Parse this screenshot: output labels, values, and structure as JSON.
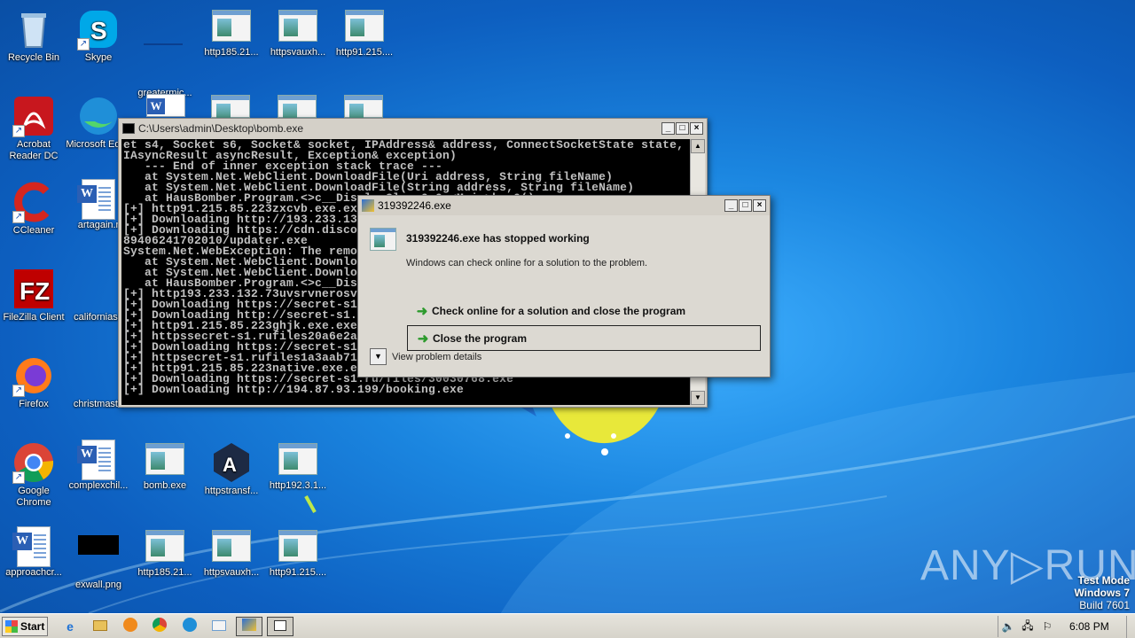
{
  "desktop": {
    "icons": [
      {
        "label": "Recycle Bin",
        "icon": "recycle-bin-icon"
      },
      {
        "label": "Skype",
        "icon": "skype-icon"
      },
      {
        "label": "greatermic...",
        "icon": "blank-file-icon"
      },
      {
        "label": "http185.21...",
        "icon": "exe-file-icon"
      },
      {
        "label": "httpsvauxh...",
        "icon": "exe-file-icon"
      },
      {
        "label": "http91.215....",
        "icon": "exe-file-icon"
      },
      {
        "label": "Acrobat Reader DC",
        "icon": "acrobat-icon"
      },
      {
        "label": "Microsoft Edge",
        "icon": "edge-icon"
      },
      {
        "label": "CCleaner",
        "icon": "ccleaner-icon"
      },
      {
        "label": "artagain.r",
        "icon": "word-doc-icon"
      },
      {
        "label": "FileZilla Client",
        "icon": "filezilla-icon"
      },
      {
        "label": "californiaso",
        "icon": "blank-file-icon"
      },
      {
        "label": "Firefox",
        "icon": "firefox-icon"
      },
      {
        "label": "christmasth",
        "icon": "blank-file-icon"
      },
      {
        "label": "Google Chrome",
        "icon": "chrome-icon"
      },
      {
        "label": "complexchil...",
        "icon": "word-doc-icon"
      },
      {
        "label": "bomb.exe",
        "icon": "exe-file-icon"
      },
      {
        "label": "httpstransf...",
        "icon": "arctic-icon"
      },
      {
        "label": "http192.3.1...",
        "icon": "exe-file-icon"
      },
      {
        "label": "approachcr...",
        "icon": "word-doc-icon"
      },
      {
        "label": "exwall.png",
        "icon": "image-file-icon"
      },
      {
        "label": "http185.21...",
        "icon": "exe-file-icon"
      },
      {
        "label": "httpsvauxh...",
        "icon": "exe-file-icon"
      },
      {
        "label": "http91.215....",
        "icon": "exe-file-icon"
      }
    ]
  },
  "console": {
    "title": "C:\\Users\\admin\\Desktop\\bomb.exe",
    "lines": [
      "et s4, Socket s6, Socket& socket, IPAddress& address, ConnectSocketState state,",
      "IAsyncResult asyncResult, Exception& exception)",
      "   --- End of inner exception stack trace ---",
      "   at System.Net.WebClient.DownloadFile(Uri address, String fileName)",
      "   at System.Net.WebClient.DownloadFile(String address, String fileName)",
      "   at HausBomber.Program.<>c__DisplayClass0_0.<Main>b__0()",
      "[+] http91.215.85.223zxcvb.exe.exe",
      "[+] Downloading http://193.233.132.73",
      "[+] Downloading https://cdn.discordapp.com/attachments/",
      "89406241702010/updater.exe",
      "System.Net.WebException: The remote",
      "   at System.Net.WebClient.Downlo",
      "   at System.Net.WebClient.Downlo",
      "   at HausBomber.Program.<>c__Dis",
      "[+] http193.233.132.73uvsrvnerosv",
      "[+] Downloading https://secret-s1",
      "[+] Downloading http://secret-s1.",
      "[+] http91.215.85.223ghjk.exe.exe",
      "[+] httpssecret-s1.rufiles20a6e2a",
      "[+] Downloading https://secret-s1",
      "[+] httpsecret-s1.rufiles1a3aab71",
      "[+] http91.215.85.223native.exe.e",
      "[+] Downloading https://secret-s1.ru/files/30030768.exe",
      "[+] Downloading http://194.87.93.199/booking.exe"
    ]
  },
  "dialog": {
    "title": "319392246.exe",
    "heading": "319392246.exe has stopped working",
    "subtext": "Windows can check online for a solution to the problem.",
    "option_check": "Check online for a solution and close the program",
    "option_close": "Close the program",
    "details": "View problem details"
  },
  "watermark": "ANY▷RUN",
  "system": {
    "test_mode": "Test Mode",
    "os": "Windows 7",
    "build": "Build 7601"
  },
  "taskbar": {
    "start_label": "Start",
    "clock": "6:08 PM"
  }
}
